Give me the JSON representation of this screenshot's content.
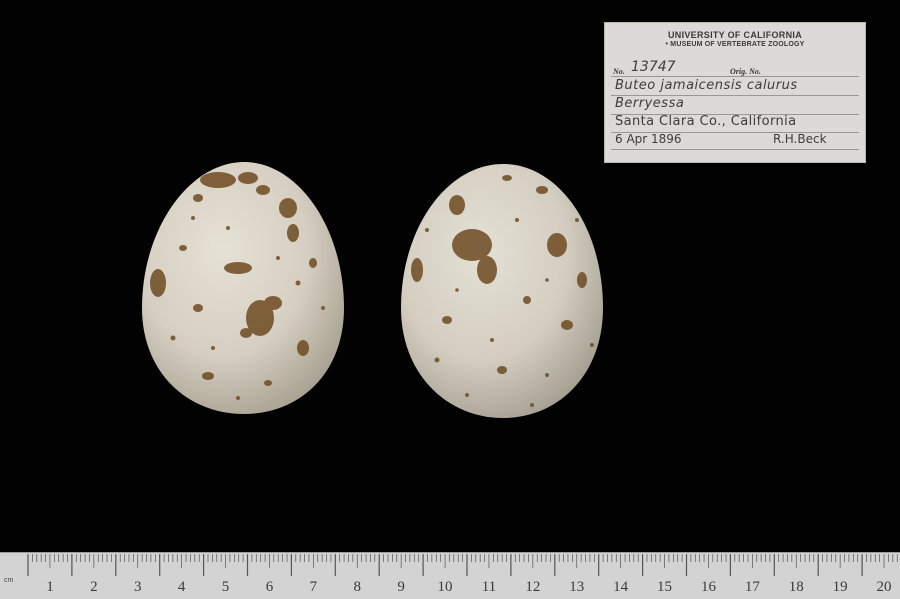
{
  "photo": {
    "subject": "Two speckled bird eggs photographed against a black background with specimen label and metric ruler"
  },
  "label": {
    "institution": "UNIVERSITY OF CALIFORNIA",
    "department": "• MUSEUM OF VERTEBRATE ZOOLOGY",
    "no_prefix": "No.",
    "catalog_number": "13747",
    "orig_prefix": "Orig. No.",
    "species": "Buteo jamaicensis calurus",
    "locality": "Berryessa",
    "county_state": "Santa Clara Co., California",
    "date": "6 Apr 1896",
    "collector": "R.H.Beck"
  },
  "ruler": {
    "unit": "cm",
    "numbers": [
      "1",
      "2",
      "3",
      "4",
      "5",
      "6",
      "7",
      "8",
      "9",
      "10",
      "11",
      "12",
      "13",
      "14",
      "15",
      "16",
      "17",
      "18",
      "19",
      "20"
    ]
  },
  "colors": {
    "background": "#020202",
    "egg_shell": "#d9d3c6",
    "speckle": "#6b4a22",
    "label_card": "#dcdad6",
    "ruler": "#d3d3d3"
  }
}
